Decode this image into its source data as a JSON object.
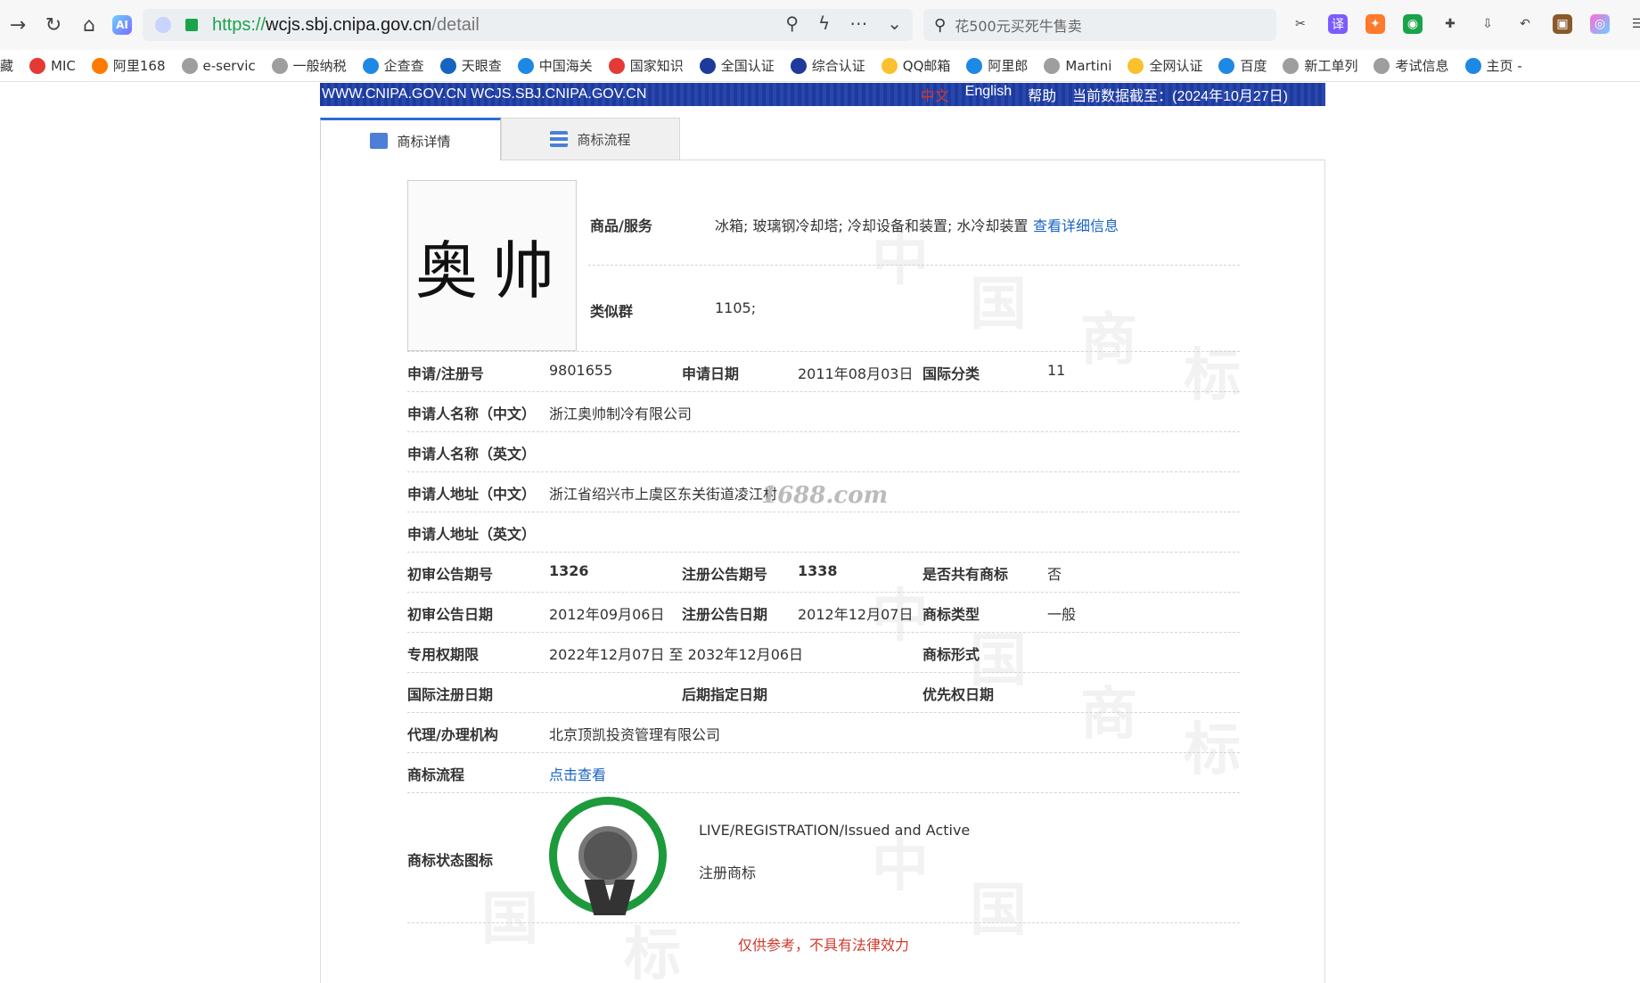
{
  "browser": {
    "url_protocol": "https://",
    "url_domain": "wcjs.sbj.cnipa.gov.cn",
    "url_path": "/detail",
    "search_placeholder": "花500元买死牛售卖",
    "ai_label": "AI"
  },
  "bookmarks": [
    "藏",
    "MIC",
    "阿里168",
    "e-servic",
    "一般纳税",
    "企查查",
    "天眼查",
    "中国海关",
    "国家知识",
    "全国认证",
    "综合认证",
    "QQ邮箱",
    "阿里郎",
    "Martini",
    "全网认证",
    "百度",
    "新工单列",
    "考试信息",
    "主页 -"
  ],
  "banner": {
    "left": "WWW.CNIPA.GOV.CN WCJS.SBJ.CNIPA.GOV.CN",
    "lang_zh": "中文",
    "lang_en": "English",
    "help": "帮助",
    "data_as_of": "当前数据截至：(2024年10月27日)"
  },
  "tabs": {
    "detail": "商标详情",
    "flow": "商标流程"
  },
  "mark": {
    "text": "奥帅"
  },
  "goods": {
    "label": "商品/服务",
    "value": "冰箱; 玻璃钢冷却塔; 冷却设备和装置; 水冷却装置",
    "link": "查看详细信息"
  },
  "similar_group": {
    "label": "类似群",
    "value": "1105;"
  },
  "fields": {
    "reg_no_label": "申请/注册号",
    "reg_no": "9801655",
    "app_date_label": "申请日期",
    "app_date": "2011年08月03日",
    "intl_class_label": "国际分类",
    "intl_class": "11",
    "applicant_cn_label": "申请人名称（中文）",
    "applicant_cn": "浙江奥帅制冷有限公司",
    "applicant_en_label": "申请人名称（英文）",
    "address_cn_label": "申请人地址（中文）",
    "address_cn": "浙江省绍兴市上虞区东关街道凌江村",
    "address_en_label": "申请人地址（英文）",
    "prelim_no_label": "初审公告期号",
    "prelim_no": "1326",
    "reg_pub_no_label": "注册公告期号",
    "reg_pub_no": "1338",
    "shared_label": "是否共有商标",
    "shared": "否",
    "prelim_date_label": "初审公告日期",
    "prelim_date": "2012年09月06日",
    "reg_pub_date_label": "注册公告日期",
    "reg_pub_date": "2012年12月07日",
    "mark_type_label": "商标类型",
    "mark_type": "一般",
    "term_label": "专用权期限",
    "term": "2022年12月07日 至 2032年12月06日",
    "mark_form_label": "商标形式",
    "intl_reg_date_label": "国际注册日期",
    "later_designation_label": "后期指定日期",
    "priority_date_label": "优先权日期",
    "agent_label": "代理/办理机构",
    "agent": "北京顶凯投资管理有限公司",
    "flow_label": "商标流程",
    "flow_link": "点击查看",
    "status_label": "商标状态图标",
    "status_en": "LIVE/REGISTRATION/Issued and Active",
    "status_cn": "注册商标"
  },
  "watermark_url": "1688.com",
  "disclaimer": "仅供参考，不具有法律效力",
  "colors": {
    "banner": "#1e3a9a",
    "link": "#1a63c4",
    "seal": "#1d9a3c",
    "disclaimer": "#d0392b"
  }
}
